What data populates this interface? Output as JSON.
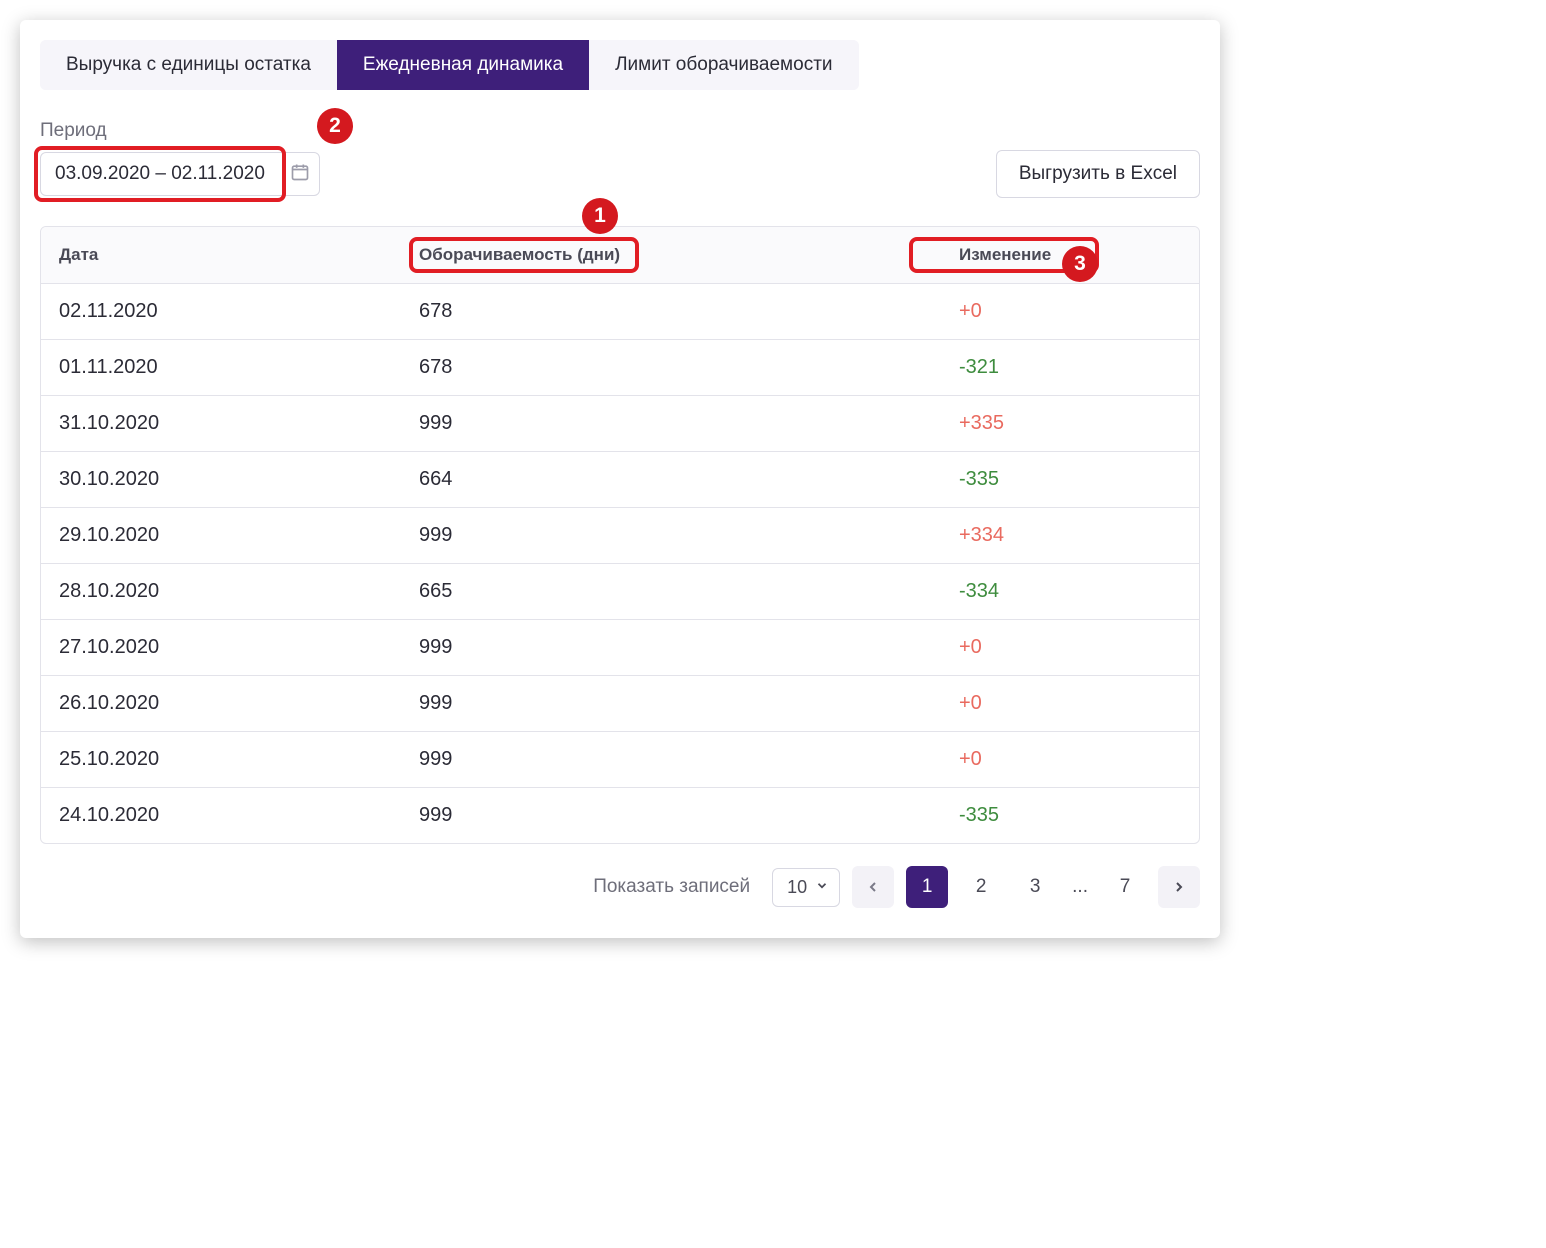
{
  "tabs": [
    {
      "label": "Выручка с единицы остатка",
      "active": false
    },
    {
      "label": "Ежедневная динамика",
      "active": true
    },
    {
      "label": "Лимит оборачиваемости",
      "active": false
    }
  ],
  "period": {
    "label": "Период",
    "value": "03.09.2020 – 02.11.2020"
  },
  "export_label": "Выгрузить в Excel",
  "columns": {
    "date": "Дата",
    "turnover": "Оборачиваемость (дни)",
    "change": "Изменение"
  },
  "rows": [
    {
      "date": "02.11.2020",
      "turnover": "678",
      "change": "+0",
      "dir": "pos"
    },
    {
      "date": "01.11.2020",
      "turnover": "678",
      "change": "-321",
      "dir": "neg"
    },
    {
      "date": "31.10.2020",
      "turnover": "999",
      "change": "+335",
      "dir": "pos"
    },
    {
      "date": "30.10.2020",
      "turnover": "664",
      "change": "-335",
      "dir": "neg"
    },
    {
      "date": "29.10.2020",
      "turnover": "999",
      "change": "+334",
      "dir": "pos"
    },
    {
      "date": "28.10.2020",
      "turnover": "665",
      "change": "-334",
      "dir": "neg"
    },
    {
      "date": "27.10.2020",
      "turnover": "999",
      "change": "+0",
      "dir": "pos"
    },
    {
      "date": "26.10.2020",
      "turnover": "999",
      "change": "+0",
      "dir": "pos"
    },
    {
      "date": "25.10.2020",
      "turnover": "999",
      "change": "+0",
      "dir": "pos"
    },
    {
      "date": "24.10.2020",
      "turnover": "999",
      "change": "-335",
      "dir": "neg"
    }
  ],
  "pager": {
    "label": "Показать записей",
    "page_size": "10",
    "pages": [
      "1",
      "2",
      "3"
    ],
    "dots": "...",
    "last": "7",
    "current": "1"
  },
  "callouts": {
    "c1": "1",
    "c2": "2",
    "c3": "3"
  }
}
